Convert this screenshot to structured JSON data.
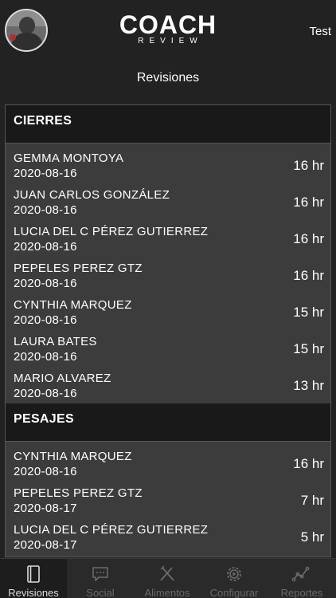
{
  "header": {
    "logo_main": "COACH",
    "logo_sub": "REVIEW",
    "user_label": "Test",
    "avatar_icon": "profile-photo"
  },
  "page": {
    "title": "Revisiones"
  },
  "sections": [
    {
      "title": "CIERRES",
      "items": [
        {
          "name": "GEMMA MONTOYA",
          "date": "2020-08-16",
          "hours": "16 hr"
        },
        {
          "name": "JUAN CARLOS  GONZÁLEZ",
          "date": "2020-08-16",
          "hours": "16 hr"
        },
        {
          "name": "LUCIA DEL C PÉREZ GUTIERREZ",
          "date": "2020-08-16",
          "hours": "16 hr"
        },
        {
          "name": "PEPELES PEREZ GTZ",
          "date": "2020-08-16",
          "hours": "16 hr"
        },
        {
          "name": "CYNTHIA MARQUEZ",
          "date": "2020-08-16",
          "hours": "15 hr"
        },
        {
          "name": "LAURA BATES",
          "date": "2020-08-16",
          "hours": "15 hr"
        },
        {
          "name": "MARIO ALVAREZ",
          "date": "2020-08-16",
          "hours": "13 hr"
        }
      ]
    },
    {
      "title": "PESAJES",
      "items": [
        {
          "name": "CYNTHIA MARQUEZ",
          "date": "2020-08-16",
          "hours": "16 hr"
        },
        {
          "name": "PEPELES PEREZ GTZ",
          "date": "2020-08-17",
          "hours": "7 hr"
        },
        {
          "name": "LUCIA DEL C PÉREZ GUTIERREZ",
          "date": "2020-08-17",
          "hours": "5 hr"
        }
      ]
    }
  ],
  "tabbar": {
    "items": [
      {
        "label": "Revisiones",
        "icon": "notebook-icon",
        "active": true
      },
      {
        "label": "Social",
        "icon": "chat-icon",
        "active": false
      },
      {
        "label": "Alimentos",
        "icon": "fork-knife-icon",
        "active": false
      },
      {
        "label": "Configurar",
        "icon": "gear-icon",
        "active": false
      },
      {
        "label": "Reportes",
        "icon": "line-chart-icon",
        "active": false
      }
    ]
  },
  "colors": {
    "background": "#222222",
    "list_background": "#3c3c3c",
    "section_background": "#191919",
    "tab_inactive": "#6a6a6a",
    "tab_active": "#dcdcdc"
  }
}
